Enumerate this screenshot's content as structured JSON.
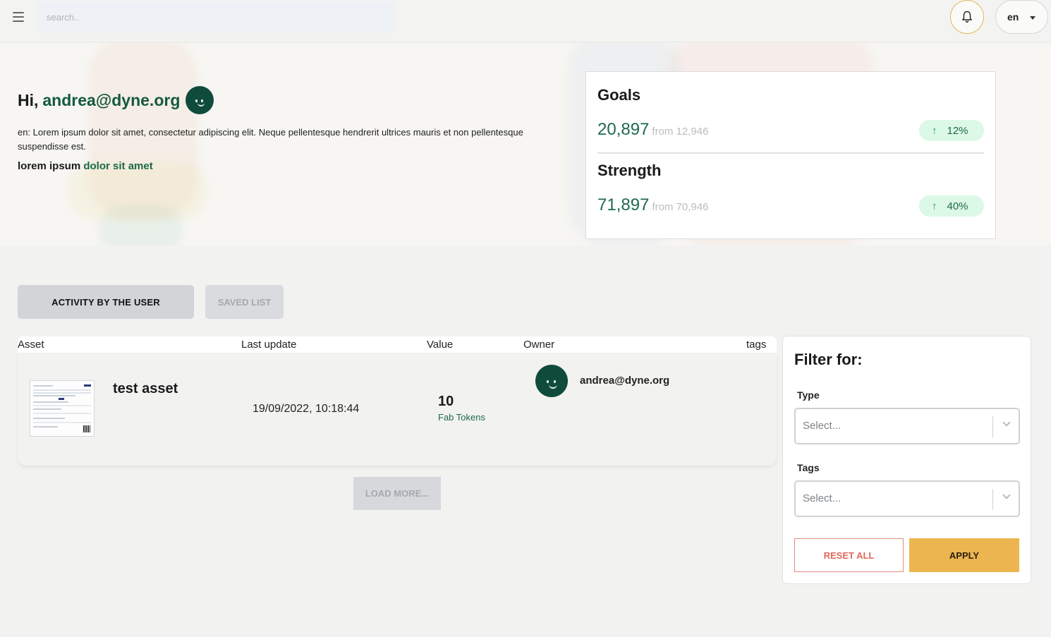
{
  "topbar": {
    "search_placeholder": "search..",
    "language": "en"
  },
  "hero": {
    "greeting": "Hi,",
    "user_email": "andrea@dyne.org",
    "description": "en: Lorem ipsum dolor sit amet, consectetur adipiscing elit. Neque pellentesque hendrerit ultrices mauris et non pellentesque suspendisse est.",
    "tagline_plain": "lorem ipsum",
    "tagline_highlight": "dolor sit amet"
  },
  "stats": [
    {
      "label": "Goals",
      "value": "20,897",
      "from": "from 12,946",
      "change": "12%",
      "trend": "up"
    },
    {
      "label": "Strength",
      "value": "71,897",
      "from": "from 70,946",
      "change": "40%",
      "trend": "up"
    }
  ],
  "tabs": [
    {
      "label": "ACTIVITY BY THE USER",
      "active": true
    },
    {
      "label": "SAVED LIST",
      "active": false
    }
  ],
  "table": {
    "columns": [
      "Asset",
      "Last update",
      "Value",
      "Owner",
      "tags"
    ],
    "rows": [
      {
        "asset": "test asset",
        "last_update": "19/09/2022, 10:18:44",
        "value": "10",
        "unit": "Fab Tokens",
        "owner": "andrea@dyne.org"
      }
    ]
  },
  "load_more": "LOAD MORE...",
  "filter": {
    "title": "Filter for:",
    "type_label": "Type",
    "type_placeholder": "Select...",
    "tags_label": "Tags",
    "tags_placeholder": "Select...",
    "reset_label": "RESET ALL",
    "apply_label": "APPLY"
  },
  "colors": {
    "accent_green": "#14593f",
    "apply_yellow": "#ecb54f",
    "reset_red": "#e0685a",
    "pill_green": "#dcf8e6"
  },
  "icons": {
    "menu": "hamburger-menu-icon",
    "notifications": "bell-icon",
    "language_caret": "caret-down-icon",
    "trend_up": "arrow-up-icon",
    "select_chevron": "chevron-down-icon"
  }
}
